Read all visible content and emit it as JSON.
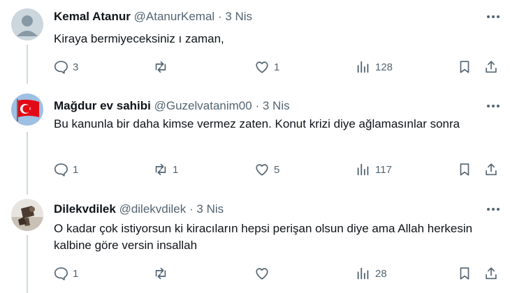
{
  "tweets": [
    {
      "name": "Kemal Atanur",
      "handle": "@AtanurKemal",
      "separator": "·",
      "time": "3 Nis",
      "text": "Kiraya bermiyeceksiniz ı zaman,",
      "replies": "3",
      "retweets": "",
      "likes": "1",
      "views": "128",
      "avatar": "default-avatar-icon"
    },
    {
      "name": "Mağdur ev sahibi",
      "handle": "@Guzelvatanim00",
      "separator": "·",
      "time": "3 Nis",
      "text": "Bu kanunla bir daha kimse vermez zaten. Konut krizi diye ağlamasınlar sonra",
      "replies": "1",
      "retweets": "1",
      "likes": "5",
      "views": "117",
      "avatar": "turkish-flag-avatar"
    },
    {
      "name": "Dilekvdilek",
      "handle": "@dilekvdilek",
      "separator": "·",
      "time": "3 Nis",
      "text": "O kadar çok istiyorsun ki kiracıların hepsi perişan olsun diye ama Allah herkesin kalbine göre versin insallah",
      "replies": "1",
      "retweets": "",
      "likes": "",
      "views": "28",
      "avatar": "photo-avatar"
    }
  ],
  "colors": {
    "text": "#0f1419",
    "muted": "#536471",
    "thread": "#cfd9de",
    "flag_red": "#e30a17"
  }
}
